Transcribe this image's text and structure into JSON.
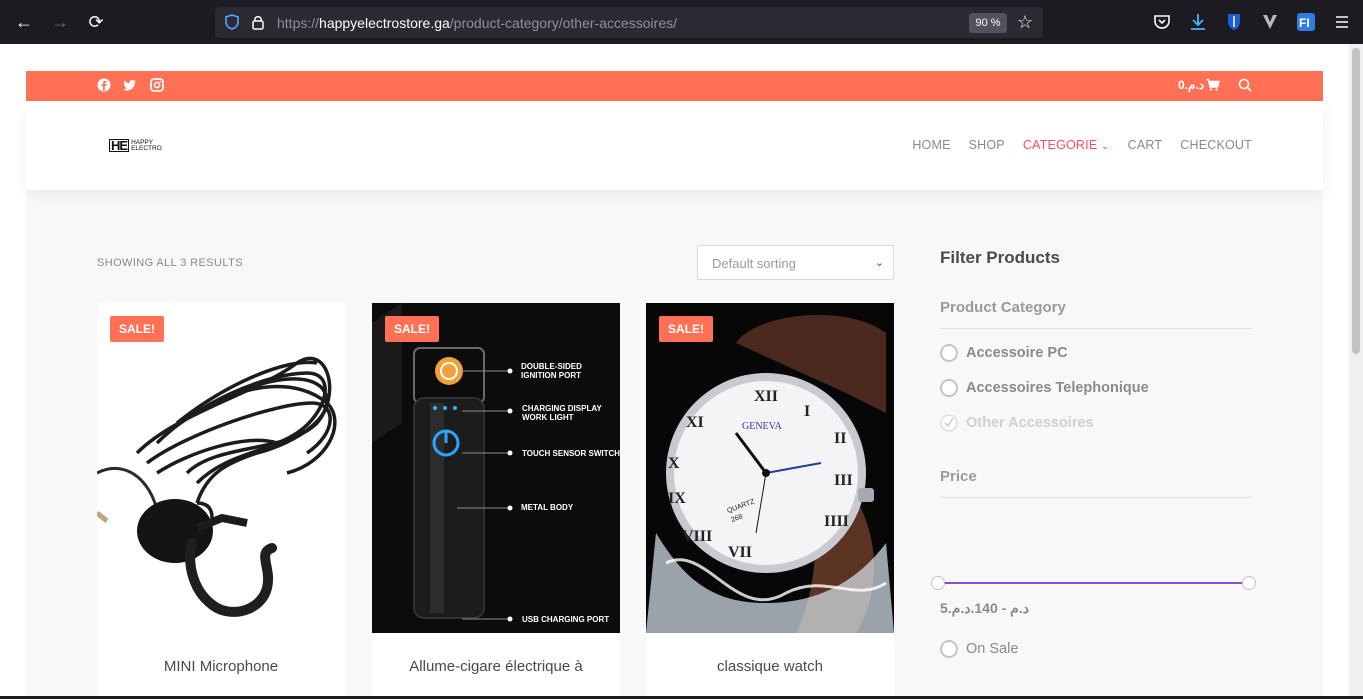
{
  "browser": {
    "url_scheme": "https://",
    "url_host": "happyelectrostore.ga",
    "url_path": "/product-category/other-accessoires/",
    "zoom": "90 %"
  },
  "topbar": {
    "cart_amount": "0.د.م"
  },
  "logo": {
    "mark": "HE",
    "line1": "HAPPY",
    "line2": "ELECTRO"
  },
  "nav": {
    "items": [
      "HOME",
      "SHOP",
      "CATEGORIE",
      "CART",
      "CHECKOUT"
    ],
    "active": "CATEGORIE"
  },
  "shop": {
    "results": "SHOWING ALL 3 RESULTS",
    "sort_selected": "Default sorting"
  },
  "products": [
    {
      "title": "MINI Microphone",
      "badge": "SALE!"
    },
    {
      "title": "Allume-cigare électrique à",
      "badge": "SALE!",
      "features": [
        "DOUBLE-SIDED IGNITION PORT",
        "CHARGING DISPLAY WORK LIGHT",
        "TOUCH SENSOR SWITCH",
        "METAL BODY",
        "USB CHARGING PORT"
      ]
    },
    {
      "title": "classique watch",
      "badge": "SALE!",
      "dial_brand": "GENEVA",
      "dial_text": "QUARTZ 268"
    }
  ],
  "sidebar": {
    "title": "Filter Products",
    "category_title": "Product Category",
    "categories": [
      {
        "label": "Accessoire PC",
        "checked": false
      },
      {
        "label": "Accessoires Telephonique",
        "checked": false
      },
      {
        "label": "Other Accessoires",
        "checked": true
      }
    ],
    "price_title": "Price",
    "price_range": "5.د.م - 140.د.م",
    "price_min": 5,
    "price_max": 140,
    "on_sale_label": "On Sale"
  },
  "colors": {
    "accent": "#ff7055",
    "nav_active": "#ff4d5f",
    "slider": "#8a4fd6"
  }
}
